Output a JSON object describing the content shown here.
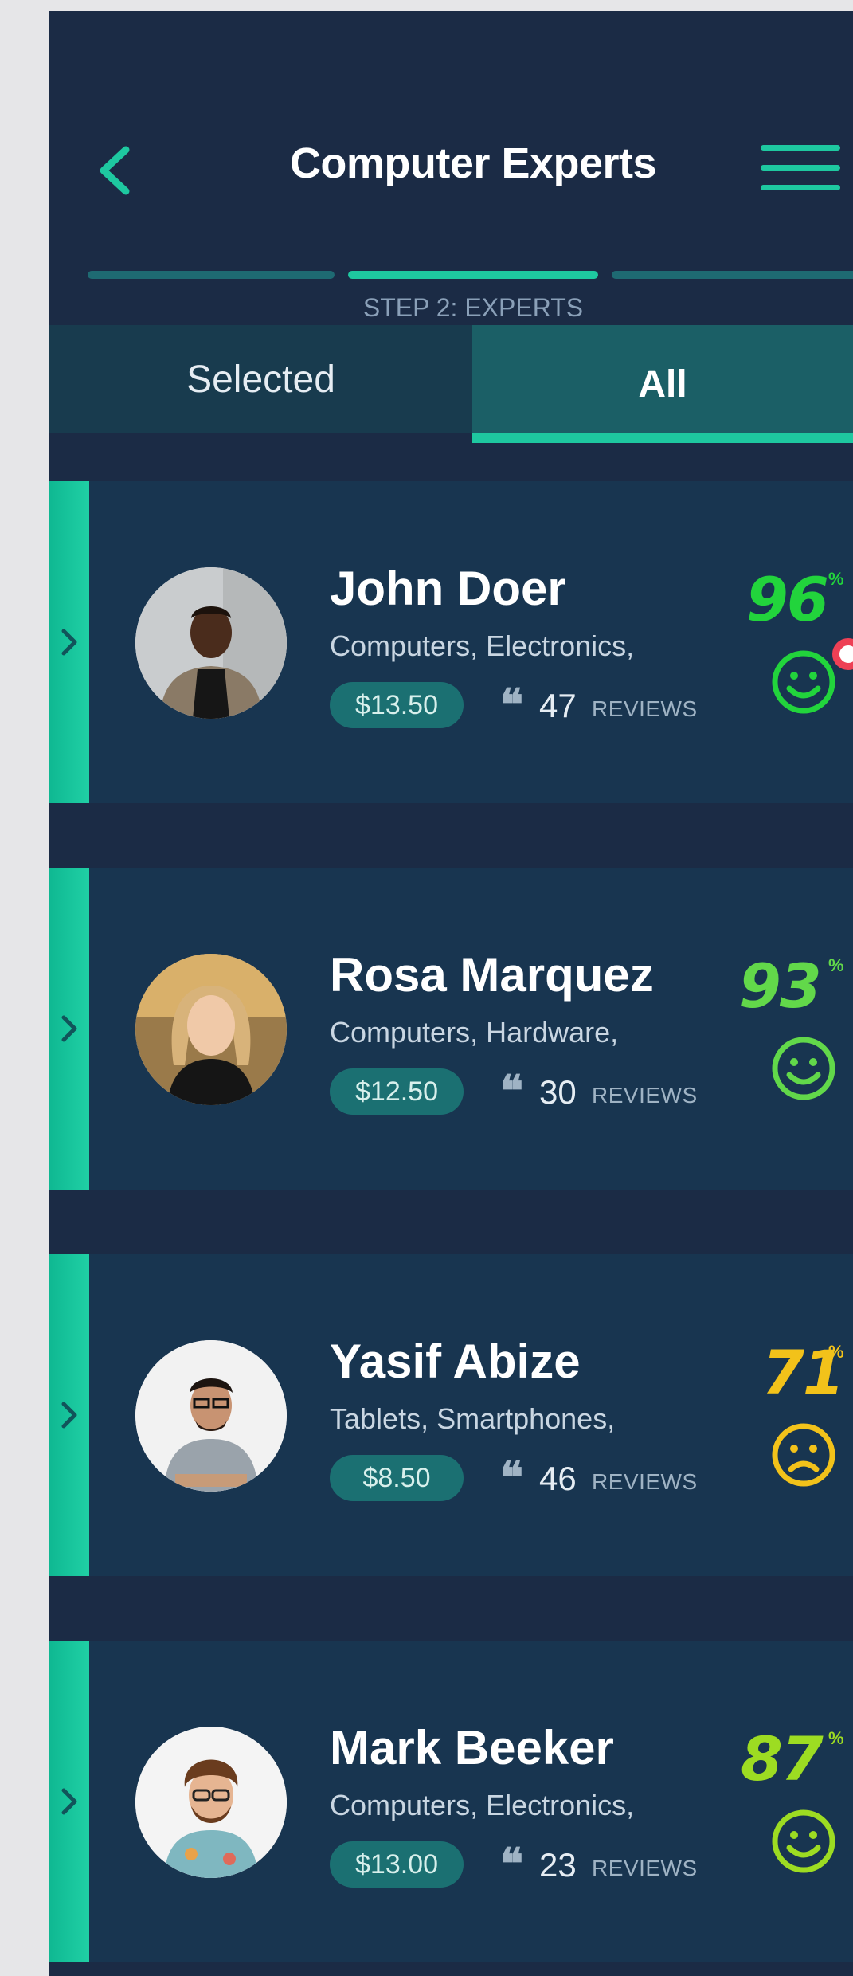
{
  "header": {
    "title": "Computer Experts"
  },
  "progress": {
    "step_label": "STEP 2: EXPERTS",
    "current_step": 2,
    "total_steps": 3
  },
  "tabs": [
    {
      "label": "Selected",
      "active": false
    },
    {
      "label": "All",
      "active": true
    }
  ],
  "experts": [
    {
      "name": "John Doer",
      "categories": "Computers, Electronics,",
      "price": "$13.50",
      "review_count": "47",
      "reviews_label": "REVIEWS",
      "score": "96",
      "score_unit": "%",
      "mood": "happy",
      "score_color": "#22d43c"
    },
    {
      "name": "Rosa Marquez",
      "categories": "Computers, Hardware,",
      "price": "$12.50",
      "review_count": "30",
      "reviews_label": "REVIEWS",
      "score": "93",
      "score_unit": "%",
      "mood": "happy",
      "score_color": "#62d84a"
    },
    {
      "name": "Yasif Abize",
      "categories": "Tablets, Smartphones,",
      "price": "$8.50",
      "review_count": "46",
      "reviews_label": "REVIEWS",
      "score": "71",
      "score_unit": "%",
      "mood": "sad",
      "score_color": "#f2c21a"
    },
    {
      "name": "Mark Beeker",
      "categories": "Computers, Electronics,",
      "price": "$13.00",
      "review_count": "23",
      "reviews_label": "REVIEWS",
      "score": "87",
      "score_unit": "%",
      "mood": "happy",
      "score_color": "#9ddc22"
    }
  ],
  "colors": {
    "accent": "#1ec8a0",
    "background": "#1b2b45",
    "card": "#183550"
  },
  "icons": [
    "chevron-left-icon",
    "hamburger-menu-icon",
    "chevron-right-icon",
    "quote-icon",
    "smiley-face-icon",
    "sad-face-icon"
  ]
}
